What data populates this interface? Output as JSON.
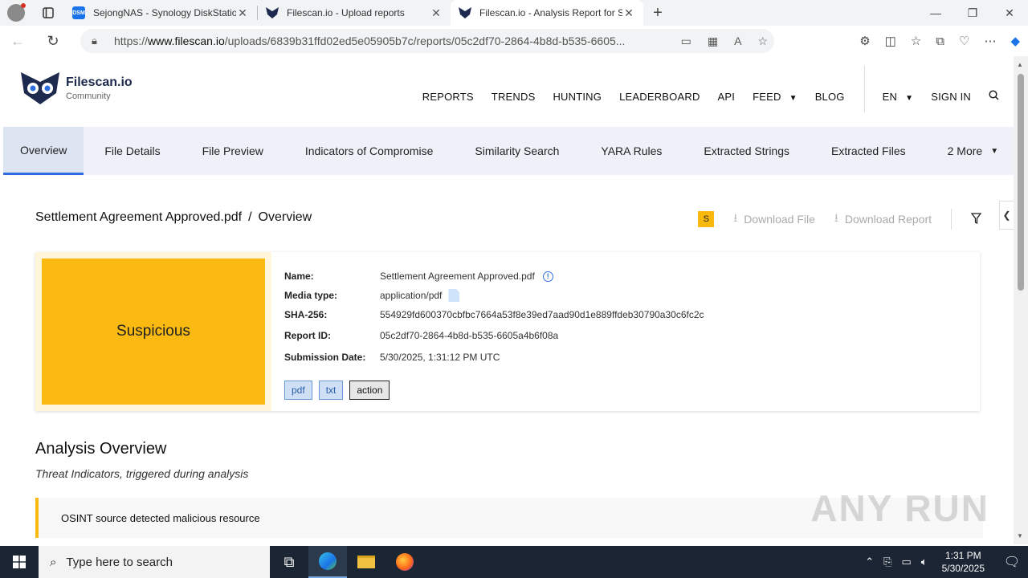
{
  "browser": {
    "tabs": [
      {
        "title": "SejongNAS - Synology DiskStatio",
        "favicon": "DSM",
        "active": false
      },
      {
        "title": "Filescan.io - Upload reports",
        "favicon": "owl",
        "active": false
      },
      {
        "title": "Filescan.io - Analysis Report for S",
        "favicon": "owl",
        "active": true
      }
    ],
    "url_prefix": "https://",
    "url_domain": "www.filescan.io",
    "url_path": "/uploads/6839b31ffd02ed5e05905b7c/reports/05c2df70-2864-4b8d-b535-6605..."
  },
  "site": {
    "logo_name": "Filescan.io",
    "logo_sub": "Community",
    "nav": [
      "REPORTS",
      "TRENDS",
      "HUNTING",
      "LEADERBOARD",
      "API",
      "FEED",
      "BLOG"
    ],
    "lang": "EN",
    "sign_in": "SIGN IN"
  },
  "subnav": {
    "tabs": [
      "Overview",
      "File Details",
      "File Preview",
      "Indicators of Compromise",
      "Similarity Search",
      "YARA Rules",
      "Extracted Strings",
      "Extracted Files",
      "2 More"
    ]
  },
  "report": {
    "filename": "Settlement Agreement Approved.pdf",
    "section": "Overview",
    "badge": "S",
    "download_file": "Download File",
    "download_report": "Download Report",
    "verdict": "Suspicious",
    "verdict_color": "#fbba12",
    "labels": {
      "name": "Name:",
      "media_type": "Media type:",
      "sha256": "SHA-256:",
      "report_id": "Report ID:",
      "submission_date": "Submission Date:"
    },
    "values": {
      "name": "Settlement Agreement Approved.pdf",
      "media_type": "application/pdf",
      "sha256": "554929fd600370cbfbc7664a53f8e39ed7aad90d1e889ffdeb30790a30c6fc2c",
      "report_id": "05c2df70-2864-4b8d-b535-6605a4b6f08a",
      "submission_date": "5/30/2025, 1:31:12 PM UTC"
    },
    "tags": [
      "pdf",
      "txt",
      "action"
    ]
  },
  "analysis": {
    "title": "Analysis Overview",
    "subtitle": "Threat Indicators, triggered during analysis",
    "indicators": [
      "OSINT source detected malicious resource"
    ]
  },
  "watermark": "ANY RUN",
  "taskbar": {
    "search_placeholder": "Type here to search",
    "time": "1:31 PM",
    "date": "5/30/2025"
  }
}
